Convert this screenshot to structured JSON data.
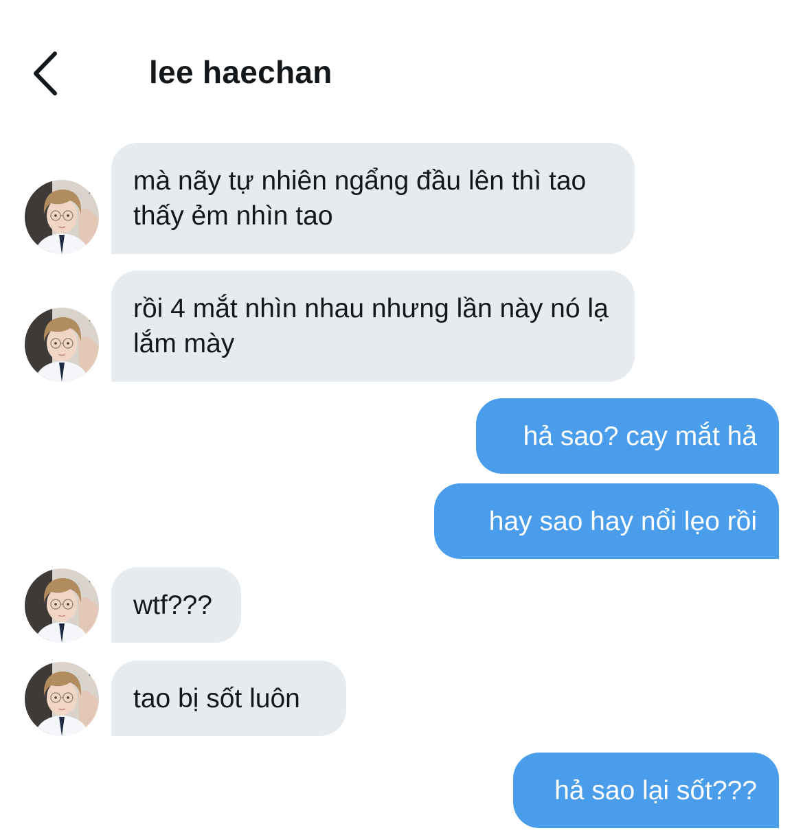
{
  "header": {
    "back_icon": "chevron-left-icon",
    "contact_name": "lee haechan"
  },
  "messages": [
    {
      "sender": "other",
      "text": "mà nãy tự nhiên ngẩng đầu lên thì tao thấy ẻm nhìn tao"
    },
    {
      "sender": "other",
      "text": "rồi 4 mắt nhìn nhau nhưng lần này nó lạ lắm mày"
    },
    {
      "sender": "me",
      "text": "hả sao? cay mắt hả"
    },
    {
      "sender": "me",
      "text": "hay sao hay nổi lẹo rồi"
    },
    {
      "sender": "other",
      "text": "wtf???"
    },
    {
      "sender": "other",
      "text": "tao bị sốt luôn"
    },
    {
      "sender": "me",
      "text": "hả sao lại sốt???"
    }
  ],
  "colors": {
    "incoming_bubble": "#e6ebf0",
    "outgoing_bubble": "#4a9deb",
    "text_dark": "#14171a",
    "text_light": "#ffffff"
  }
}
